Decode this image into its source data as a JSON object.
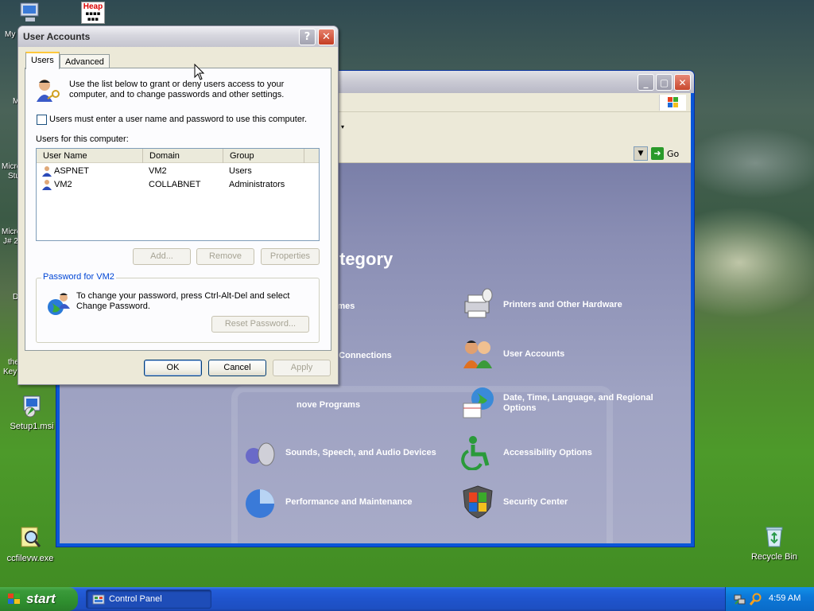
{
  "desktop": {
    "icons": [
      {
        "label": "Setup1.msi",
        "icon": "installer-icon"
      },
      {
        "label": "ccfilevw.exe",
        "icon": "magnifier-file-icon"
      },
      {
        "label": "Recycle Bin",
        "icon": "recycle-bin-icon"
      }
    ],
    "partial_labels": {
      "my": "My",
      "m": "M",
      "micro1": "Micro",
      "stu": "Stu",
      "micro2": "Micro",
      "j2": "J# 2",
      "d": "D",
      "the": "the",
      "key": "Key"
    },
    "heap_icon_label": "Heap"
  },
  "control_panel": {
    "window_title": "",
    "go_label": "Go",
    "heading_partial": "tegory",
    "categories": [
      {
        "label": "e and Themes",
        "icon": "appearance-icon"
      },
      {
        "label": "Printers and Other Hardware",
        "icon": "printer-icon"
      },
      {
        "label": "d Internet Connections",
        "icon": "network-icon"
      },
      {
        "label": "User Accounts",
        "icon": "users-icon"
      },
      {
        "label": "nove Programs",
        "icon": "add-remove-icon"
      },
      {
        "label": "Date, Time, Language, and Regional Options",
        "icon": "date-time-icon"
      },
      {
        "label": "Sounds, Speech, and Audio Devices",
        "icon": "sound-icon"
      },
      {
        "label": "Accessibility Options",
        "icon": "accessibility-icon"
      },
      {
        "label": "Performance and Maintenance",
        "icon": "performance-icon"
      },
      {
        "label": "Security Center",
        "icon": "shield-icon"
      }
    ]
  },
  "user_accounts": {
    "title": "User Accounts",
    "help_label": "?",
    "close_label": "✕",
    "tabs": [
      "Users",
      "Advanced"
    ],
    "intro_text": "Use the list below to grant or deny users access to your computer, and to change passwords and other settings.",
    "checkbox_label": "Users must enter a user name and password to use this computer.",
    "checkbox_checked": false,
    "list_label": "Users for this computer:",
    "columns": [
      "User Name",
      "Domain",
      "Group"
    ],
    "rows": [
      {
        "name": "ASPNET",
        "domain": "VM2",
        "group": "Users"
      },
      {
        "name": "VM2",
        "domain": "COLLABNET",
        "group": "Administrators"
      }
    ],
    "buttons": {
      "add": "Add...",
      "remove": "Remove",
      "properties": "Properties",
      "reset_password": "Reset Password...",
      "ok": "OK",
      "cancel": "Cancel",
      "apply": "Apply"
    },
    "password_group_label": "Password for VM2",
    "password_text": "To change your password, press Ctrl-Alt-Del and select Change Password."
  },
  "taskbar": {
    "start_label": "start",
    "task_label": "Control Panel",
    "clock": "4:59 AM"
  },
  "colors": {
    "xp_blue": "#245edb",
    "start_green": "#3a9a3a",
    "group_label_blue": "#0046d5"
  }
}
